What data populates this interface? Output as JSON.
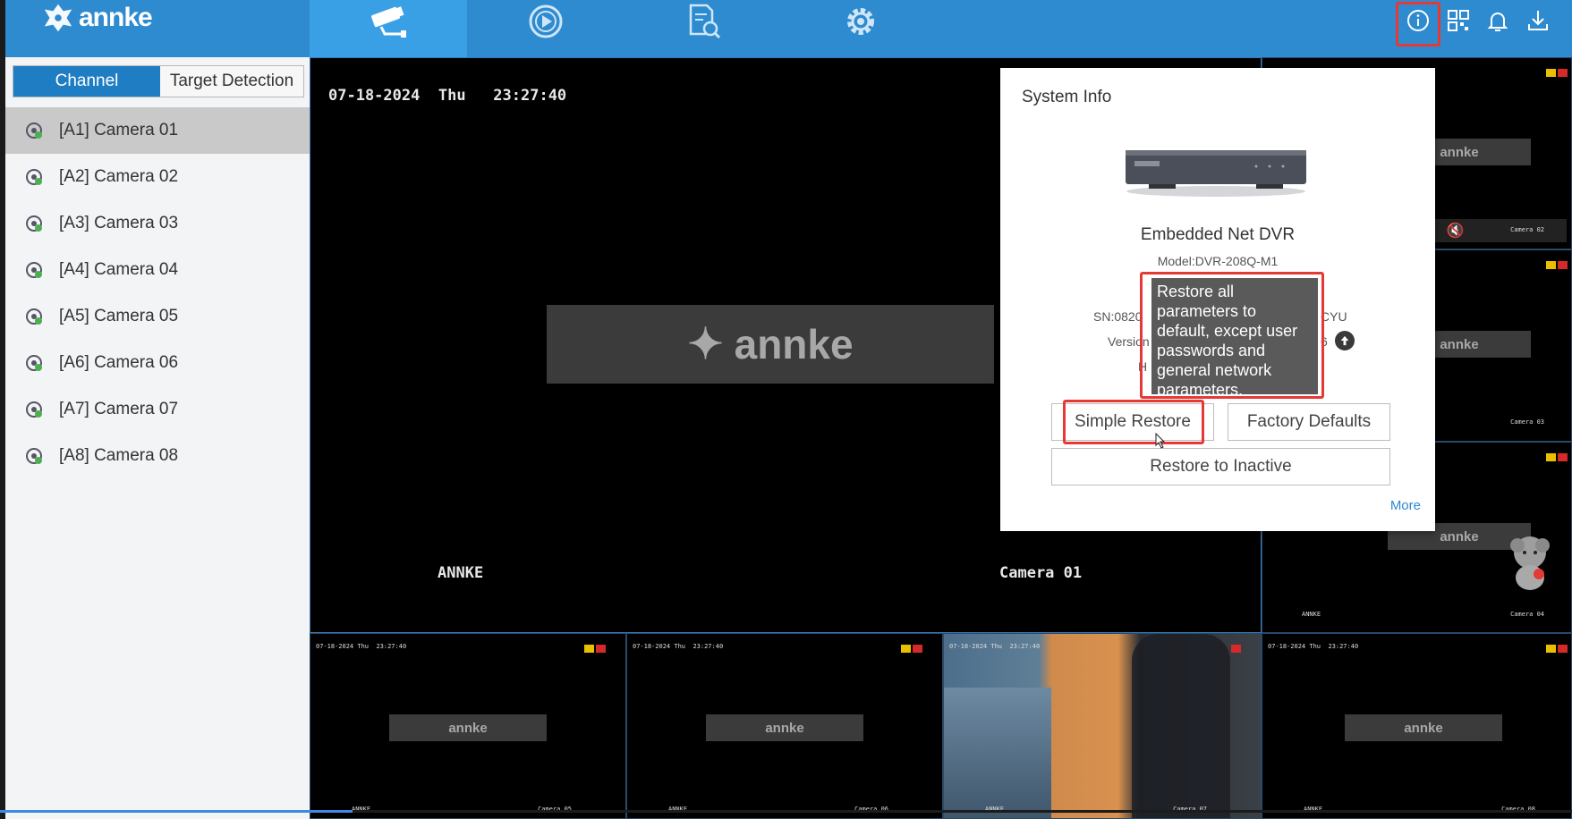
{
  "brand": {
    "logo_text": "annke"
  },
  "topnav": {
    "tabs": [
      {
        "name": "live-view",
        "icon": "cctv-camera-icon",
        "active": true
      },
      {
        "name": "playback",
        "icon": "playback-icon",
        "active": false
      },
      {
        "name": "search",
        "icon": "file-search-icon",
        "active": false
      },
      {
        "name": "settings",
        "icon": "gear-icon",
        "active": false
      }
    ],
    "right_icons": [
      "info-icon",
      "qr-code-icon",
      "bell-icon",
      "download-icon"
    ]
  },
  "sidebar": {
    "tabs": [
      {
        "label": "Channel",
        "active": true
      },
      {
        "label": "Target Detection",
        "active": false
      }
    ],
    "cameras": [
      "[A1] Camera 01",
      "[A2] Camera 02",
      "[A3] Camera 03",
      "[A4] Camera 04",
      "[A5] Camera 05",
      "[A6] Camera 06",
      "[A7] Camera 07",
      "[A8] Camera 08"
    ],
    "selected_index": 0
  },
  "main_view": {
    "date": "07-18-2024",
    "day": "Thu",
    "time": "23:27:40",
    "left_label": "ANNKE",
    "camera_label": "Camera 01",
    "watermark": "annke"
  },
  "thumbnails": {
    "osd_date": "07-18-2024 Thu",
    "osd_time": "23:27:40",
    "watermark": "annke",
    "left_label": "ANNKE",
    "labels": [
      "Camera 02",
      "Camera 03",
      "Camera 04",
      "Camera 05",
      "Camera 06",
      "Camera 07",
      "Camera 08"
    ]
  },
  "system_info": {
    "title": "System Info",
    "device_name": "Embedded Net DVR",
    "model": "Model:DVR-208Q-M1",
    "sn_prefix": "SN:0820",
    "sn_suffix": "CYU",
    "version_prefix": "Version",
    "version_suffix": "6",
    "hw_prefix": "H",
    "tooltip": "Restore all parameters to default, except user passwords and general network parameters.",
    "buttons": {
      "simple_restore": "Simple Restore",
      "factory_defaults": "Factory Defaults",
      "restore_inactive": "Restore to Inactive"
    },
    "more": "More"
  },
  "progress": {
    "fraction": 0.224
  },
  "colors": {
    "topbar": "#2e8bd0",
    "active_tab": "#3aa0e6",
    "channel_tab": "#1f7dc3",
    "highlight": "#e53935",
    "link": "#2d8ad0"
  }
}
